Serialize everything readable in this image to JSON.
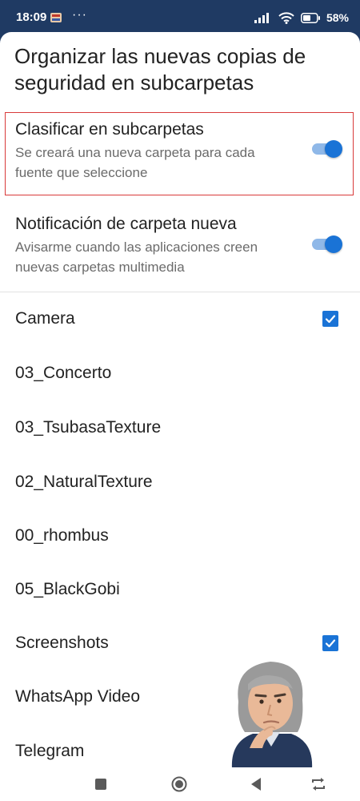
{
  "status_bar": {
    "time": "18:09",
    "app_icon": "app-notification-icon",
    "more": "···",
    "battery": "58%",
    "icons": [
      "signal-icon",
      "wifi-icon",
      "battery-icon"
    ]
  },
  "sheet": {
    "title": "Organizar las nuevas copias de seguridad en subcarpetas",
    "settings": [
      {
        "title": "Clasificar en subcarpetas",
        "description": "Se creará una nueva carpeta para cada fuente que seleccione",
        "enabled": true,
        "highlighted": true
      },
      {
        "title": "Notificación de carpeta nueva",
        "description": "Avisarme cuando las aplicaciones creen nuevas carpetas multimedia",
        "enabled": true,
        "highlighted": false
      }
    ],
    "folders": [
      {
        "name": "Camera",
        "checked": true
      },
      {
        "name": "03_Concerto",
        "checked": false
      },
      {
        "name": "03_TsubasaTexture",
        "checked": false
      },
      {
        "name": "02_NaturalTexture",
        "checked": false
      },
      {
        "name": "00_rhombus",
        "checked": false
      },
      {
        "name": "05_BlackGobi",
        "checked": false
      },
      {
        "name": "Screenshots",
        "checked": true
      },
      {
        "name": "WhatsApp Video",
        "checked": false
      },
      {
        "name": "Telegram",
        "checked": false
      }
    ]
  },
  "nav_bar": {
    "buttons": [
      "recents-square-icon",
      "home-circle-icon",
      "back-triangle-icon",
      "rotate-icon"
    ]
  },
  "colors": {
    "status_bg": "#1f3a63",
    "accent": "#1a73d6",
    "highlight_border": "#d93a3a"
  }
}
